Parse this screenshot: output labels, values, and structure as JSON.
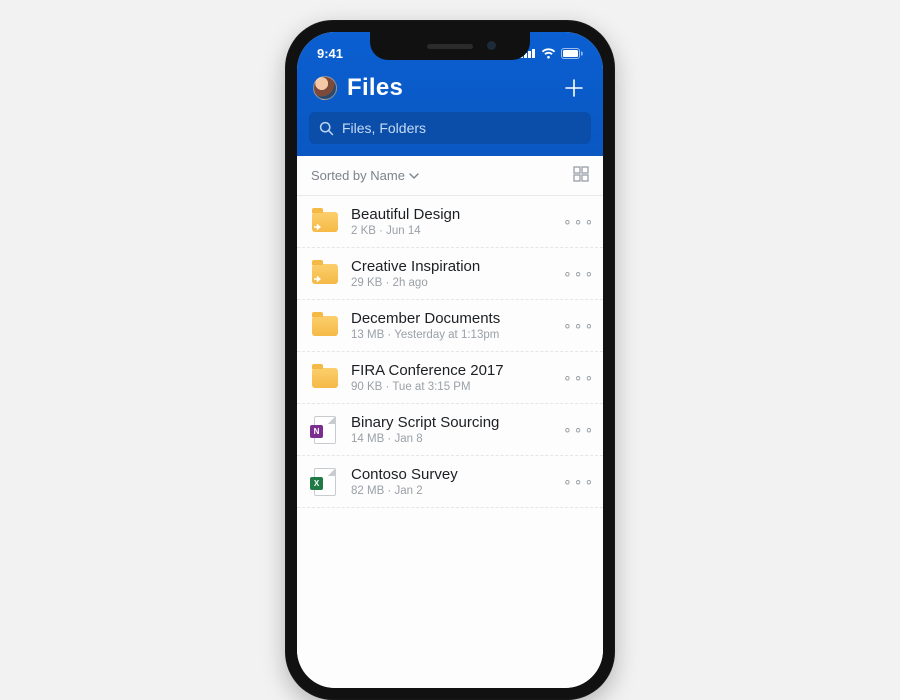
{
  "status": {
    "time": "9:41"
  },
  "header": {
    "title": "Files"
  },
  "search": {
    "placeholder": "Files, Folders"
  },
  "sort": {
    "label": "Sorted by Name"
  },
  "items": [
    {
      "icon": "folder-shared",
      "title": "Beautiful Design",
      "meta": "2 KB · Jun 14"
    },
    {
      "icon": "folder-shared",
      "title": "Creative Inspiration",
      "meta": "29 KB · 2h ago"
    },
    {
      "icon": "folder",
      "title": "December Documents",
      "meta": "13 MB · Yesterday at 1:13pm"
    },
    {
      "icon": "folder",
      "title": "FIRA Conference 2017",
      "meta": "90 KB · Tue at 3:15 PM"
    },
    {
      "icon": "onenote",
      "title": "Binary Script Sourcing",
      "meta": "14 MB · Jan 8"
    },
    {
      "icon": "excel",
      "title": "Contoso Survey",
      "meta": "82 MB · Jan 2"
    }
  ],
  "glyphs": {
    "more": "∘∘∘",
    "badge_onenote": "N",
    "badge_excel": "X"
  }
}
